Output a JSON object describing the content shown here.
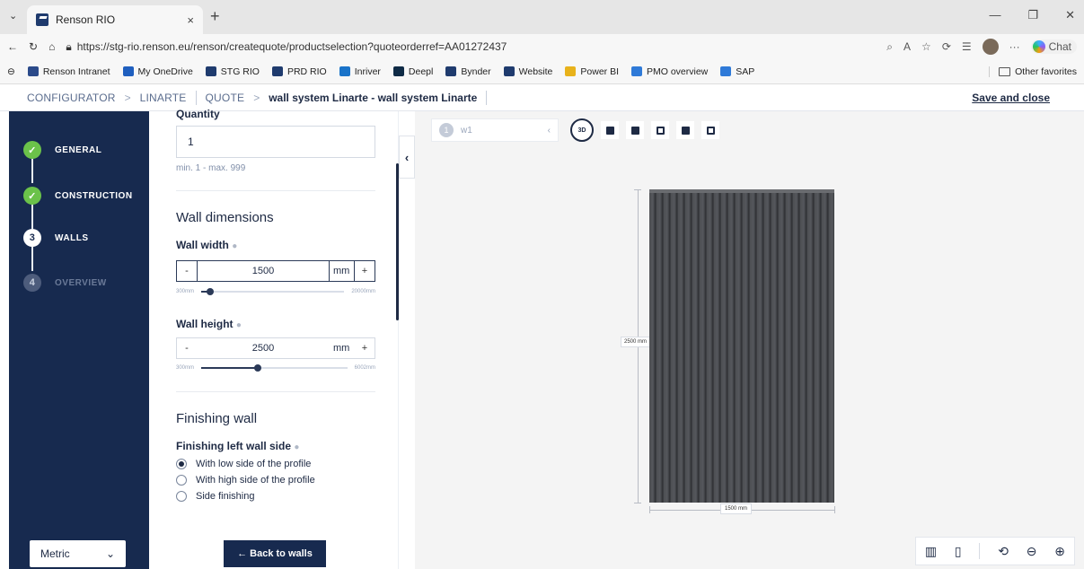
{
  "browser": {
    "tab_title": "Renson RIO",
    "tab_close": "×",
    "new_tab": "+",
    "url": "https://stg-rio.renson.eu/renson/createquote/productselection?quoteorderref=AA01272437",
    "chat_label": "Chat",
    "bookmarks": [
      {
        "label": "Renson Intranet",
        "color": "#2b4a8a"
      },
      {
        "label": "My OneDrive",
        "color": "#1f5fbf"
      },
      {
        "label": "STG RIO",
        "color": "#1f3b6e"
      },
      {
        "label": "PRD RIO",
        "color": "#1f3b6e"
      },
      {
        "label": "Inriver",
        "color": "#1a73c9"
      },
      {
        "label": "Deepl",
        "color": "#0f2b46"
      },
      {
        "label": "Bynder",
        "color": "#1f3b6e"
      },
      {
        "label": "Website",
        "color": "#1f3b6e"
      },
      {
        "label": "Power BI",
        "color": "#e8b21b"
      },
      {
        "label": "PMO overview",
        "color": "#2f7ad8"
      },
      {
        "label": "SAP",
        "color": "#2f7ad8"
      }
    ],
    "other_favorites": "Other favorites"
  },
  "header": {
    "crumb1": "CONFIGURATOR",
    "crumb2": "LINARTE",
    "crumb3": "QUOTE",
    "title": "wall system Linarte - wall system Linarte",
    "save_close": "Save and close",
    "sep": ">"
  },
  "steps": [
    {
      "num": "✓",
      "label": "GENERAL",
      "state": "done"
    },
    {
      "num": "✓",
      "label": "CONSTRUCTION",
      "state": "done"
    },
    {
      "num": "3",
      "label": "WALLS",
      "state": "current"
    },
    {
      "num": "4",
      "label": "OVERVIEW",
      "state": "disabled"
    }
  ],
  "units": {
    "selected": "Metric"
  },
  "form": {
    "quantity_label": "Quantity",
    "quantity_value": "1",
    "quantity_hint": "min. 1 - max. 999",
    "wall_dimensions_heading": "Wall dimensions",
    "wall_width_label": "Wall width",
    "wall_width_value": "1500",
    "wall_width_unit": "mm",
    "wall_width_min": "300mm",
    "wall_width_max": "20000mm",
    "wall_width_fraction": 0.061,
    "wall_height_label": "Wall height",
    "wall_height_value": "2500",
    "wall_height_unit": "mm",
    "wall_height_min": "300mm",
    "wall_height_max": "6002mm",
    "wall_height_fraction": 0.386,
    "minus": "-",
    "plus": "+",
    "finishing_heading": "Finishing wall",
    "finishing_left_label": "Finishing left wall side",
    "options": [
      {
        "label": "With low side of the profile",
        "checked": true
      },
      {
        "label": "With high side of the profile",
        "checked": false
      },
      {
        "label": "Side finishing",
        "checked": false
      }
    ],
    "back_button": "← Back to walls"
  },
  "viewer": {
    "wall_num": "1",
    "wall_name": "w1",
    "mode_3d": "3D",
    "height_dim": "2500 mm",
    "width_dim": "1500 mm"
  }
}
